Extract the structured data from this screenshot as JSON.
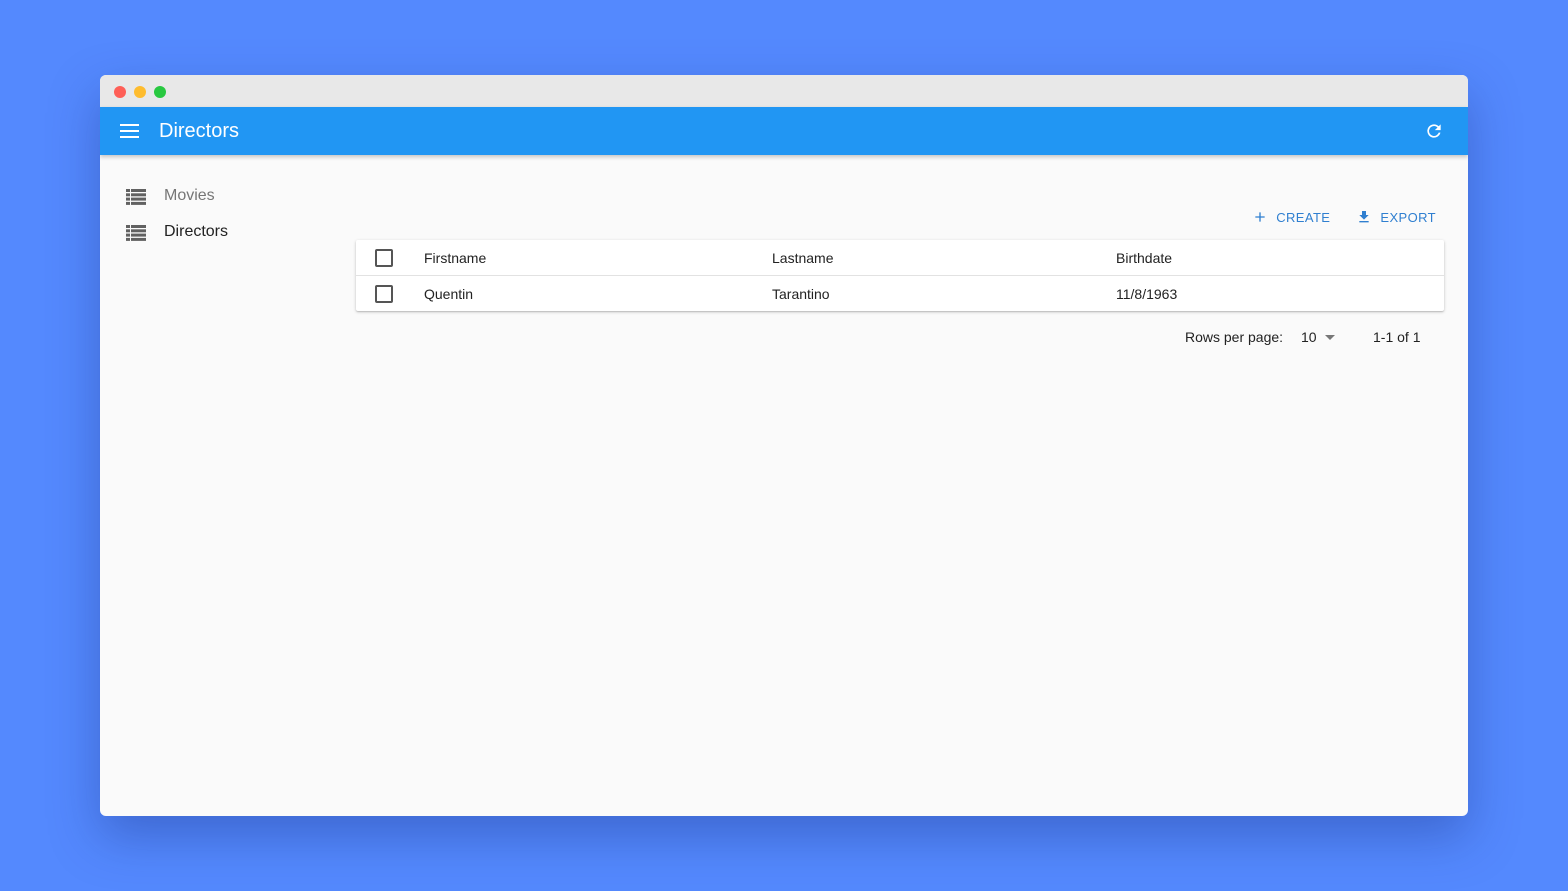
{
  "appbar": {
    "title": "Directors"
  },
  "sidebar": {
    "items": [
      {
        "label": "Movies",
        "active": false
      },
      {
        "label": "Directors",
        "active": true
      }
    ]
  },
  "toolbar": {
    "create_label": "CREATE",
    "export_label": "EXPORT"
  },
  "table": {
    "columns": [
      "Firstname",
      "Lastname",
      "Birthdate"
    ],
    "rows": [
      {
        "firstname": "Quentin",
        "lastname": "Tarantino",
        "birthdate": "11/8/1963"
      }
    ]
  },
  "pagination": {
    "rows_per_page_label": "Rows per page:",
    "rows_per_page_value": "10",
    "range": "1-1 of 1"
  },
  "colors": {
    "background": "#5489fe",
    "appbar": "#2196f3",
    "accent": "#2f7fd0"
  }
}
